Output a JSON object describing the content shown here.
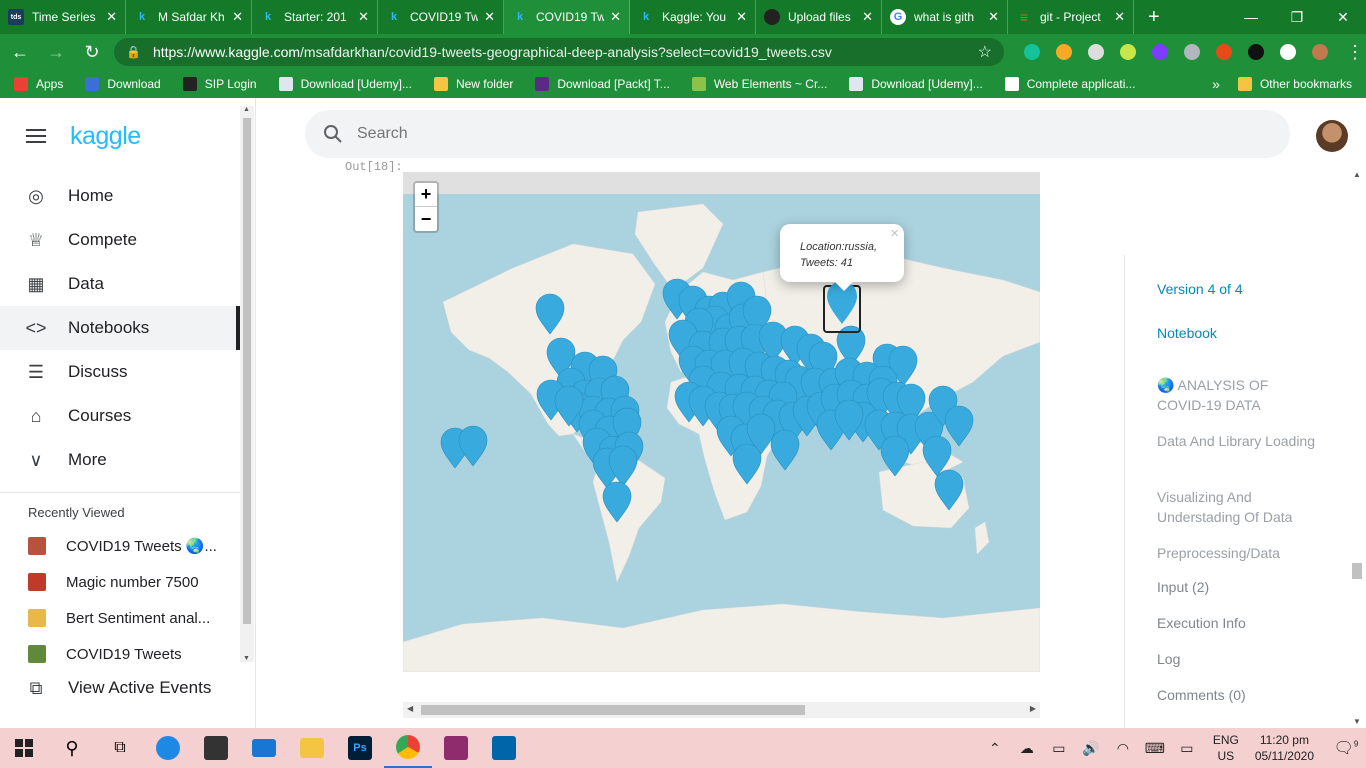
{
  "browser": {
    "tabs": [
      {
        "title": "Time Series",
        "fav": "tds",
        "active": false
      },
      {
        "title": "M Safdar Kh",
        "fav": "k",
        "active": false
      },
      {
        "title": "Starter: 201",
        "fav": "k",
        "active": false
      },
      {
        "title": "COVID19 Tw",
        "fav": "k",
        "active": false
      },
      {
        "title": "COVID19 Tw",
        "fav": "k",
        "active": true
      },
      {
        "title": "Kaggle: You",
        "fav": "k",
        "active": false
      },
      {
        "title": "Upload files",
        "fav": "gh",
        "active": false
      },
      {
        "title": "what is gith",
        "fav": "g",
        "active": false
      },
      {
        "title": "git - Project",
        "fav": "git",
        "active": false
      }
    ],
    "url_host": "https://www.kaggle.com",
    "url_path": "/msafdarkhan/covid19-tweets-geographical-deep-analysis?select=covid19_tweets.csv",
    "bookmarks": [
      {
        "label": "Apps",
        "color": "#e94235"
      },
      {
        "label": "Download",
        "color": "#3b6fd6"
      },
      {
        "label": "SIP Login",
        "color": "#222222"
      },
      {
        "label": "Download [Udemy]...",
        "color": "#dfe6ef"
      },
      {
        "label": "New folder",
        "color": "#f4c542"
      },
      {
        "label": "Download [Packt] T...",
        "color": "#5b2a86"
      },
      {
        "label": "Web Elements ~ Cr...",
        "color": "#8bc34a"
      },
      {
        "label": "Download [Udemy]...",
        "color": "#dfe6ef"
      },
      {
        "label": "Complete applicati...",
        "color": "#ffffff"
      }
    ],
    "more_bookmarks": "»",
    "other_bookmarks": "Other bookmarks"
  },
  "kaggle": {
    "logo": "kaggle",
    "nav": [
      {
        "label": "Home",
        "icon": "compass-icon",
        "glyph": "◎",
        "active": false
      },
      {
        "label": "Compete",
        "icon": "trophy-icon",
        "glyph": "♕",
        "active": false
      },
      {
        "label": "Data",
        "icon": "table-icon",
        "glyph": "▦",
        "active": false
      },
      {
        "label": "Notebooks",
        "icon": "code-icon",
        "glyph": "<>",
        "active": true
      },
      {
        "label": "Discuss",
        "icon": "comment-icon",
        "glyph": "☰",
        "active": false
      },
      {
        "label": "Courses",
        "icon": "school-icon",
        "glyph": "⌂",
        "active": false
      },
      {
        "label": "More",
        "icon": "chevron-down-icon",
        "glyph": "∨",
        "active": false
      }
    ],
    "recently_viewed_title": "Recently Viewed",
    "recently_viewed": [
      {
        "label": "COVID19 Tweets 🌏...",
        "color": "#b5533c"
      },
      {
        "label": "Magic number 7500",
        "color": "#c0392b"
      },
      {
        "label": "Bert Sentiment anal...",
        "color": "#e8b84a"
      },
      {
        "label": "COVID19 Tweets",
        "color": "#5f8a3b"
      }
    ],
    "view_events": "View Active Events",
    "search_placeholder": "Search",
    "output_label": "Out[18]:"
  },
  "map": {
    "popup_location": "Location:russia,",
    "popup_tweets": "Tweets: 41",
    "zoom_in": "+",
    "zoom_out": "−",
    "marker_color": "#38aadd"
  },
  "toc": {
    "version": "Version 4 of 4",
    "notebook": "Notebook",
    "sections": [
      "🌏 ANALYSIS OF COVID-19 DATA",
      "Data And Library Loading",
      "Visualizing And Understading Of Data",
      "Preprocessing/Data Cleaning"
    ],
    "input": "Input (2)",
    "execution": "Execution Info",
    "log": "Log",
    "comments": "Comments (0)"
  },
  "taskbar": {
    "lang1": "ENG",
    "lang2": "US",
    "time": "11:20 pm",
    "date": "05/11/2020",
    "notif_count": "9"
  }
}
